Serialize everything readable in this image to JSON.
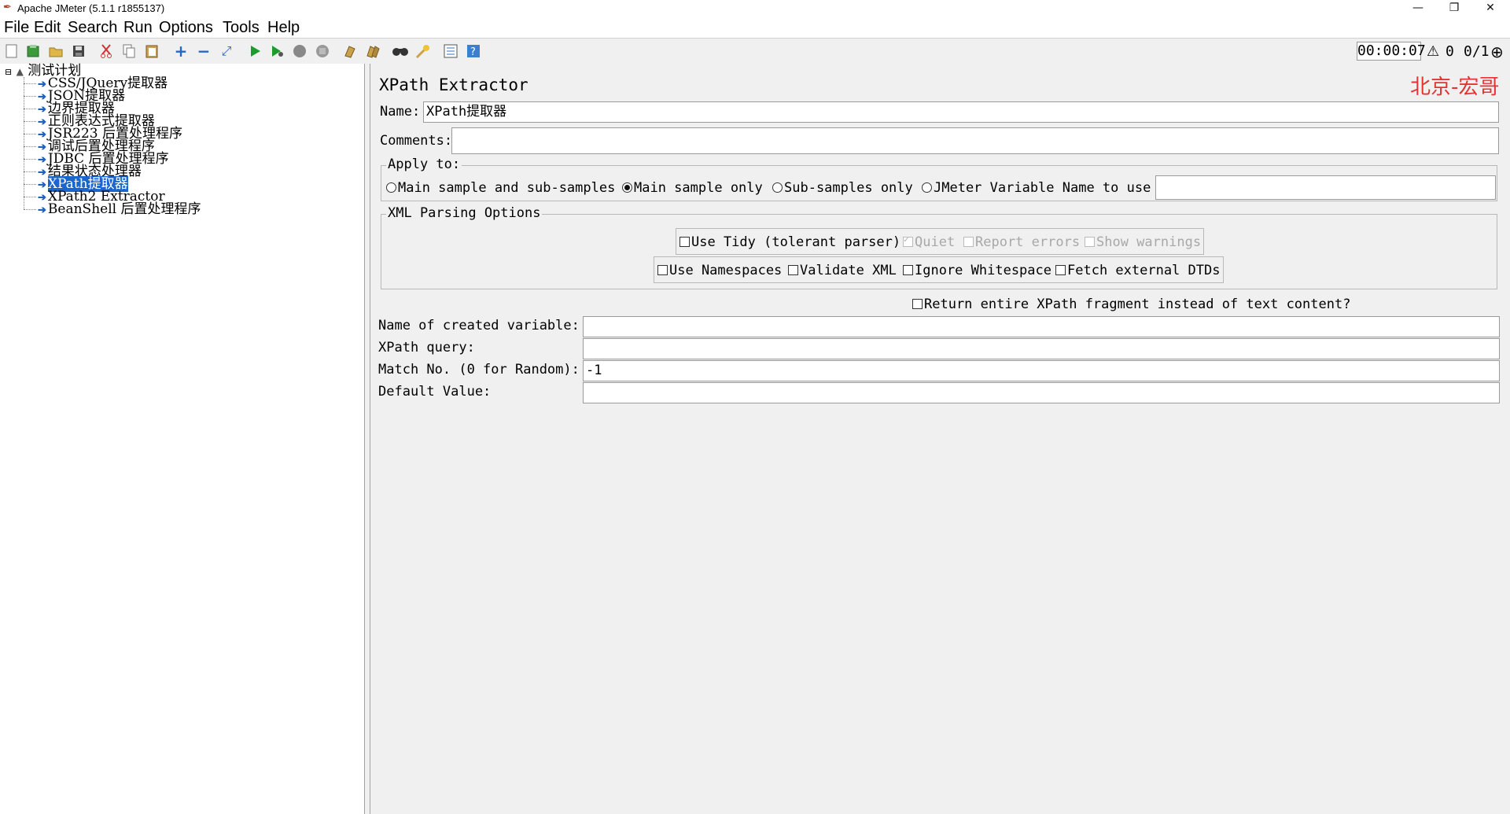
{
  "window": {
    "title": "Apache JMeter (5.1.1 r1855137)",
    "minimize": "—",
    "restore": "❐",
    "close": "✕"
  },
  "menu": [
    {
      "label": "File"
    },
    {
      "label": "Edit"
    },
    {
      "label": "Search"
    },
    {
      "label": "Run"
    },
    {
      "label": "Options"
    },
    {
      "label": "Tools"
    },
    {
      "label": "Help"
    }
  ],
  "toolbar": {
    "icons": [
      "new-icon",
      "templates-icon",
      "open-icon",
      "save-icon",
      "cut-icon",
      "copy-icon",
      "paste-icon",
      "expand-icon",
      "collapse-icon",
      "toggle-icon",
      "start-icon",
      "start-no-pause-icon",
      "stop-icon",
      "shutdown-icon",
      "clear-icon",
      "clear-all-icon",
      "search-icon",
      "reset-search-icon",
      "function-helper-icon",
      "help-icon"
    ],
    "timer": "00:00:07",
    "warning_icon": "⚠",
    "error_count": "0",
    "threads": "0/1"
  },
  "tree": {
    "root": "测试计划",
    "items": [
      {
        "label": "CSS/JQuery提取器"
      },
      {
        "label": "JSON提取器"
      },
      {
        "label": "边界提取器"
      },
      {
        "label": "正则表达式提取器"
      },
      {
        "label": "JSR223 后置处理程序"
      },
      {
        "label": "调试后置处理程序"
      },
      {
        "label": "JDBC 后置处理程序"
      },
      {
        "label": "结果状态处理器"
      },
      {
        "label": "XPath提取器",
        "selected": true
      },
      {
        "label": "XPath2 Extractor"
      },
      {
        "label": "BeanShell 后置处理程序"
      }
    ]
  },
  "panel": {
    "title": "XPath Extractor",
    "watermark": "北京-宏哥",
    "name_label": "Name:",
    "name_value": "XPath提取器",
    "comments_label": "Comments:",
    "comments_value": "",
    "apply_to": {
      "legend": "Apply to:",
      "options": [
        {
          "label": "Main sample and sub-samples",
          "selected": false
        },
        {
          "label": "Main sample only",
          "selected": true
        },
        {
          "label": "Sub-samples only",
          "selected": false
        },
        {
          "label": "JMeter Variable Name to use",
          "selected": false
        }
      ],
      "variable_value": ""
    },
    "xml_options": {
      "legend": "XML Parsing Options",
      "use_tidy": "Use Tidy (tolerant parser)",
      "quiet": "Quiet",
      "report_errors": "Report errors",
      "show_warnings": "Show warnings",
      "use_namespaces": "Use Namespaces",
      "validate_xml": "Validate XML",
      "ignore_whitespace": "Ignore Whitespace",
      "fetch_dtds": "Fetch external DTDs"
    },
    "return_fragment": "Return entire XPath fragment instead of text content?",
    "fields": {
      "created_variable_label": "Name of created variable:",
      "created_variable_value": "",
      "xpath_query_label": "XPath query:",
      "xpath_query_value": "",
      "match_no_label": "Match No. (0 for Random):",
      "match_no_value": "-1",
      "default_value_label": "Default Value:",
      "default_value_value": ""
    }
  },
  "colors": {
    "selection": "#1a66cc",
    "watermark": "#e53333",
    "panel_bg": "#f0f0f0"
  }
}
